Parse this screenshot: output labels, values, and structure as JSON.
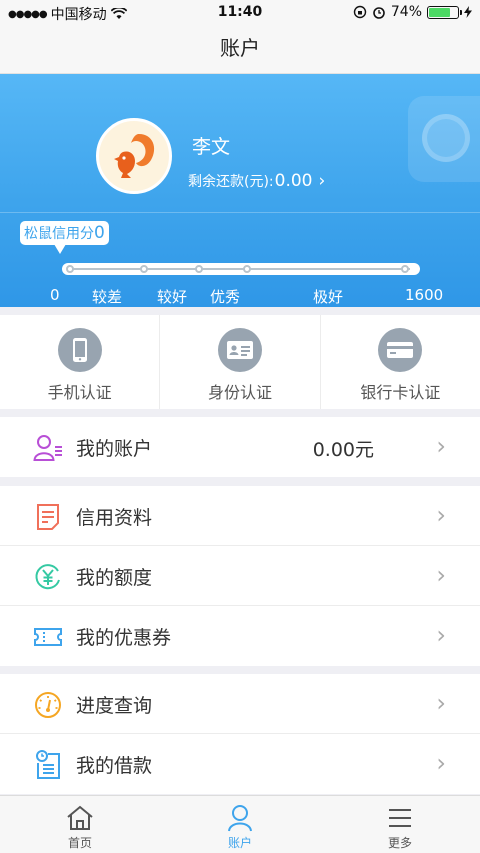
{
  "status_bar": {
    "signal_dots": "●●●●●",
    "carrier": "中国移动",
    "time": "11:40",
    "battery_percent": "74%",
    "battery_level": 0.74
  },
  "nav": {
    "title": "账户"
  },
  "profile": {
    "name": "李文",
    "balance_label": "剩余还款(元):",
    "balance_value": "0.00",
    "credit_label": "松鼠信用分",
    "credit_score": "0",
    "scale": {
      "min": "0",
      "max": "1600",
      "levels": [
        "较差",
        "较好",
        "优秀",
        "极好"
      ]
    }
  },
  "verify": [
    {
      "label": "手机认证",
      "icon": "phone-icon"
    },
    {
      "label": "身份认证",
      "icon": "id-card-icon"
    },
    {
      "label": "银行卡认证",
      "icon": "bank-card-icon"
    }
  ],
  "menu": {
    "account": {
      "label": "我的账户",
      "value": "0.00元",
      "icon": "user-account-icon",
      "color": "#b84fd6"
    },
    "credit_info": {
      "label": "信用资料",
      "icon": "document-icon",
      "color": "#f0705a"
    },
    "quota": {
      "label": "我的额度",
      "icon": "yen-icon",
      "color": "#35c9a3"
    },
    "coupons": {
      "label": "我的优惠券",
      "icon": "ticket-icon",
      "color": "#3ea4ec"
    },
    "progress": {
      "label": "进度查询",
      "icon": "gauge-icon",
      "color": "#f5a623"
    },
    "loans": {
      "label": "我的借款",
      "icon": "calendar-list-icon",
      "color": "#3ea4ec"
    }
  },
  "tabs": [
    {
      "label": "首页",
      "icon": "home-icon"
    },
    {
      "label": "账户",
      "icon": "user-icon"
    },
    {
      "label": "更多",
      "icon": "menu-icon"
    }
  ],
  "colors": {
    "accent": "#3ea4ec",
    "header": "#4aaef2"
  }
}
